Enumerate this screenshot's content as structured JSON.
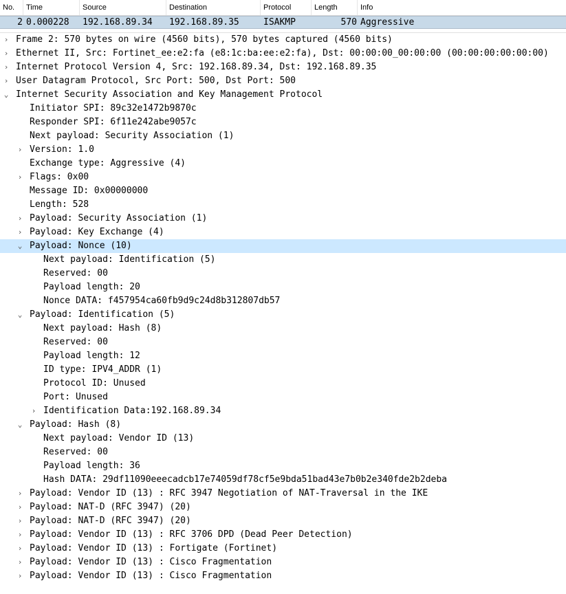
{
  "columns": {
    "no": "No.",
    "time": "Time",
    "source": "Source",
    "destination": "Destination",
    "protocol": "Protocol",
    "length": "Length",
    "info": "Info"
  },
  "packet": {
    "no": "2",
    "time": "0.000228",
    "source": "192.168.89.34",
    "destination": "192.168.89.35",
    "protocol": "ISAKMP",
    "length": "570",
    "info": "Aggressive"
  },
  "tree": [
    {
      "depth": 0,
      "expander": "collapsed",
      "text": "Frame 2: 570 bytes on wire (4560 bits), 570 bytes captured (4560 bits)"
    },
    {
      "depth": 0,
      "expander": "collapsed",
      "text": "Ethernet II, Src: Fortinet_ee:e2:fa (e8:1c:ba:ee:e2:fa), Dst: 00:00:00_00:00:00 (00:00:00:00:00:00)"
    },
    {
      "depth": 0,
      "expander": "collapsed",
      "text": "Internet Protocol Version 4, Src: 192.168.89.34, Dst: 192.168.89.35"
    },
    {
      "depth": 0,
      "expander": "collapsed",
      "text": "User Datagram Protocol, Src Port: 500, Dst Port: 500"
    },
    {
      "depth": 0,
      "expander": "expanded",
      "text": "Internet Security Association and Key Management Protocol"
    },
    {
      "depth": 1,
      "expander": "none",
      "text": "Initiator SPI: 89c32e1472b9870c"
    },
    {
      "depth": 1,
      "expander": "none",
      "text": "Responder SPI: 6f11e242abe9057c"
    },
    {
      "depth": 1,
      "expander": "none",
      "text": "Next payload: Security Association (1)"
    },
    {
      "depth": 1,
      "expander": "collapsed",
      "text": "Version: 1.0"
    },
    {
      "depth": 1,
      "expander": "none",
      "text": "Exchange type: Aggressive (4)"
    },
    {
      "depth": 1,
      "expander": "collapsed",
      "text": "Flags: 0x00"
    },
    {
      "depth": 1,
      "expander": "none",
      "text": "Message ID: 0x00000000"
    },
    {
      "depth": 1,
      "expander": "none",
      "text": "Length: 528"
    },
    {
      "depth": 1,
      "expander": "collapsed",
      "text": "Payload: Security Association (1)"
    },
    {
      "depth": 1,
      "expander": "collapsed",
      "text": "Payload: Key Exchange (4)"
    },
    {
      "depth": 1,
      "expander": "expanded",
      "text": "Payload: Nonce (10)",
      "selected": true
    },
    {
      "depth": 2,
      "expander": "none",
      "text": "Next payload: Identification (5)"
    },
    {
      "depth": 2,
      "expander": "none",
      "text": "Reserved: 00"
    },
    {
      "depth": 2,
      "expander": "none",
      "text": "Payload length: 20"
    },
    {
      "depth": 2,
      "expander": "none",
      "text": "Nonce DATA: f457954ca60fb9d9c24d8b312807db57"
    },
    {
      "depth": 1,
      "expander": "expanded",
      "text": "Payload: Identification (5)"
    },
    {
      "depth": 2,
      "expander": "none",
      "text": "Next payload: Hash (8)"
    },
    {
      "depth": 2,
      "expander": "none",
      "text": "Reserved: 00"
    },
    {
      "depth": 2,
      "expander": "none",
      "text": "Payload length: 12"
    },
    {
      "depth": 2,
      "expander": "none",
      "text": "ID type: IPV4_ADDR (1)"
    },
    {
      "depth": 2,
      "expander": "none",
      "text": "Protocol ID: Unused"
    },
    {
      "depth": 2,
      "expander": "none",
      "text": "Port: Unused"
    },
    {
      "depth": 2,
      "expander": "collapsed",
      "text": "Identification Data:192.168.89.34"
    },
    {
      "depth": 1,
      "expander": "expanded",
      "text": "Payload: Hash (8)"
    },
    {
      "depth": 2,
      "expander": "none",
      "text": "Next payload: Vendor ID (13)"
    },
    {
      "depth": 2,
      "expander": "none",
      "text": "Reserved: 00"
    },
    {
      "depth": 2,
      "expander": "none",
      "text": "Payload length: 36"
    },
    {
      "depth": 2,
      "expander": "none",
      "text": "Hash DATA: 29df11090eeecadcb17e74059df78cf5e9bda51bad43e7b0b2e340fde2b2deba"
    },
    {
      "depth": 1,
      "expander": "collapsed",
      "text": "Payload: Vendor ID (13) : RFC 3947 Negotiation of NAT-Traversal in the IKE"
    },
    {
      "depth": 1,
      "expander": "collapsed",
      "text": "Payload: NAT-D (RFC 3947) (20)"
    },
    {
      "depth": 1,
      "expander": "collapsed",
      "text": "Payload: NAT-D (RFC 3947) (20)"
    },
    {
      "depth": 1,
      "expander": "collapsed",
      "text": "Payload: Vendor ID (13) : RFC 3706 DPD (Dead Peer Detection)"
    },
    {
      "depth": 1,
      "expander": "collapsed",
      "text": "Payload: Vendor ID (13) : Fortigate (Fortinet)"
    },
    {
      "depth": 1,
      "expander": "collapsed",
      "text": "Payload: Vendor ID (13) : Cisco Fragmentation"
    },
    {
      "depth": 1,
      "expander": "collapsed",
      "text": "Payload: Vendor ID (13) : Cisco Fragmentation"
    }
  ],
  "glyphs": {
    "collapsed": "›",
    "expanded": "⌄",
    "none": ""
  }
}
